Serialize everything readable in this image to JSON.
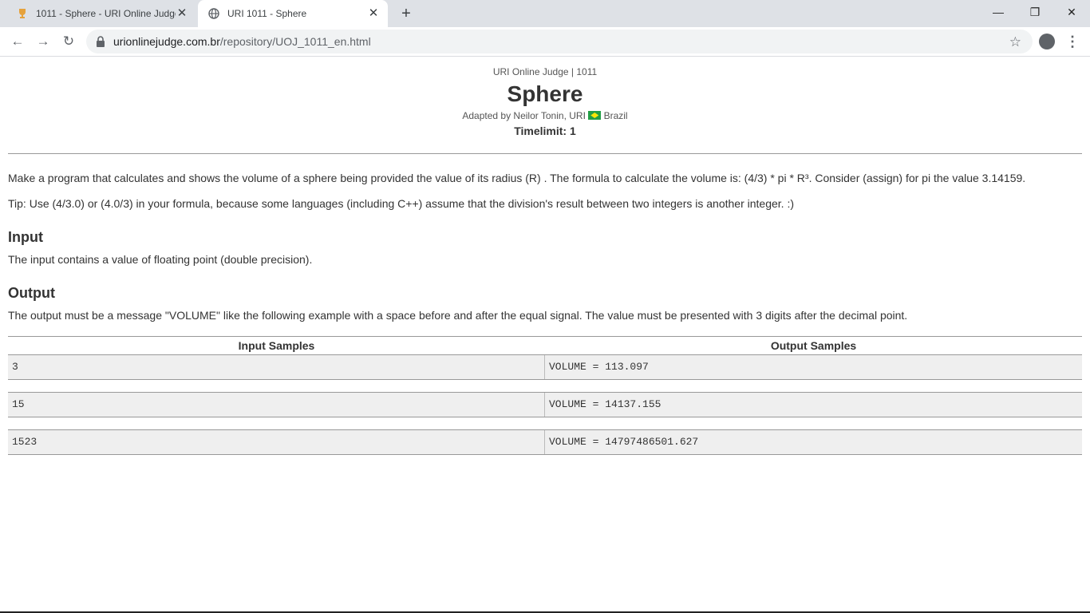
{
  "browser": {
    "tabs": [
      {
        "title": "1011 - Sphere - URI Online Judge",
        "icon": "trophy-icon",
        "active": false
      },
      {
        "title": "URI 1011 - Sphere",
        "icon": "globe-icon",
        "active": true
      }
    ],
    "new_tab_label": "+",
    "url_host": "urionlinejudge.com.br",
    "url_path": "/repository/UOJ_1011_en.html"
  },
  "page": {
    "subtitle": "URI Online Judge | 1011",
    "title": "Sphere",
    "adapted_by": "Adapted by Neilor Tonin, URI",
    "country": "Brazil",
    "timelimit": "Timelimit: 1",
    "description": "Make a program that calculates and shows the volume of a sphere being provided the value of its radius (R) . The formula to calculate the volume is: (4/3) * pi * R³. Consider (assign) for pi the value 3.14159.",
    "tip": "Tip: Use (4/3.0) or (4.0/3) in your formula, because some languages (including C++) assume that the division's result between two integers is another integer. :)",
    "input_heading": "Input",
    "input_text": "The input contains a value of floating point (double precision).",
    "output_heading": "Output",
    "output_text": "The output must be a message \"VOLUME\" like the following example with a space before and after the equal signal. The value must be presented with 3 digits after the decimal point.",
    "samples": {
      "input_header": "Input Samples",
      "output_header": "Output Samples",
      "rows": [
        {
          "input": "3",
          "output": "VOLUME = 113.097"
        },
        {
          "input": "15",
          "output": "VOLUME = 14137.155"
        },
        {
          "input": "1523",
          "output": "VOLUME = 14797486501.627"
        }
      ]
    }
  }
}
